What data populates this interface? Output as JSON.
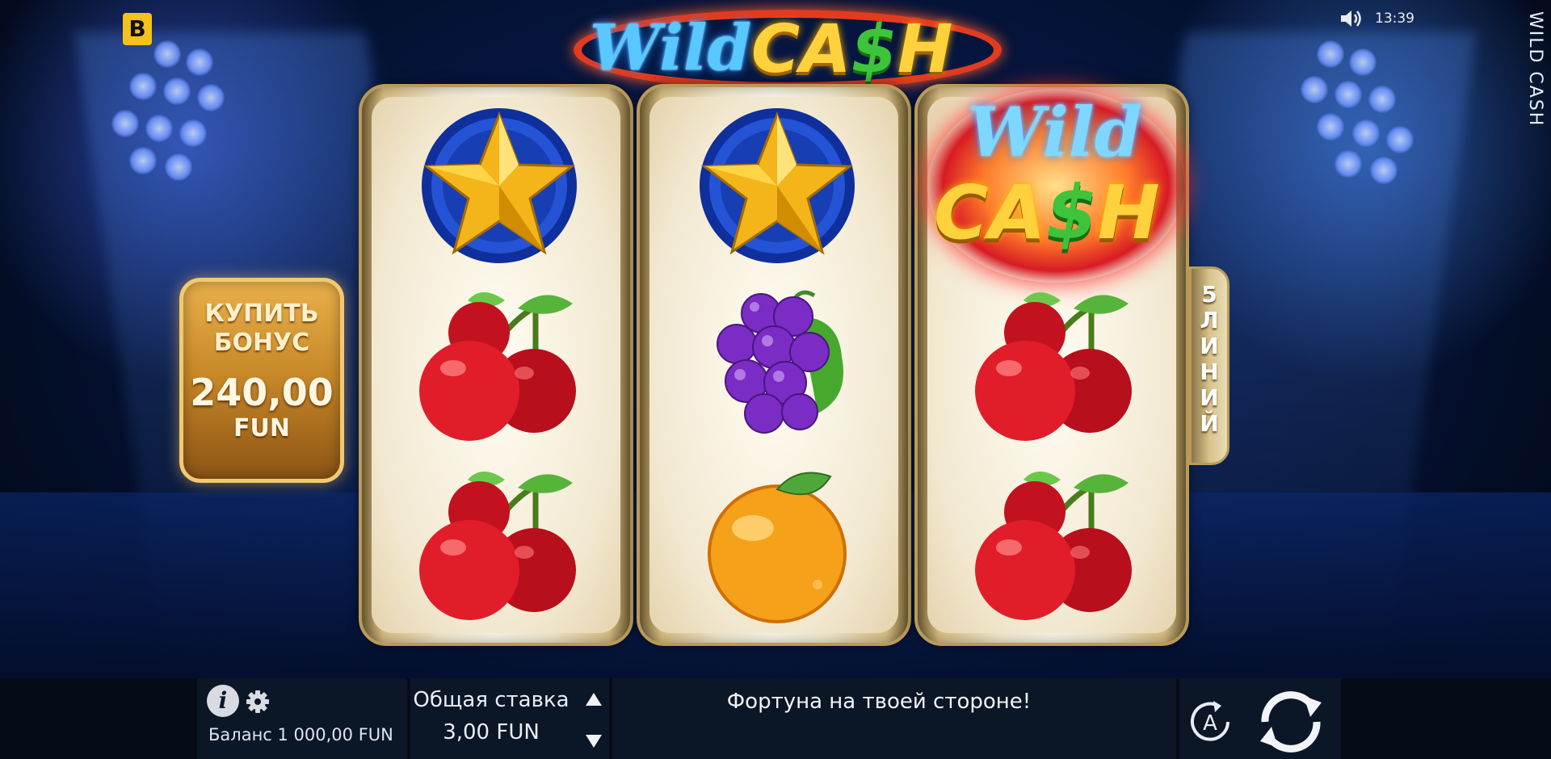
{
  "header": {
    "brand_logo_letter": "B",
    "time": "13:39",
    "side_title": "WILD CASH",
    "sound_icon": "speaker-icon"
  },
  "game_logo": {
    "word1": "Wild",
    "word2_part1": "CA",
    "word2_dollar": "$",
    "word2_part2": "H"
  },
  "buy_bonus": {
    "line1": "КУПИТЬ",
    "line2": "БОНУС",
    "amount": "240,00",
    "currency": "FUN"
  },
  "lines_tab": {
    "count": "5",
    "letters": [
      "Л",
      "И",
      "Н",
      "И",
      "Й"
    ]
  },
  "reels": [
    [
      "star",
      "cherry",
      "cherry"
    ],
    [
      "star",
      "grapes",
      "orange"
    ],
    [
      "wild",
      "cherry",
      "cherry"
    ]
  ],
  "wild_symbol": {
    "word1": "Wild",
    "word2_part1": "CA",
    "word2_dollar": "$",
    "word2_part2": "H"
  },
  "bottom_bar": {
    "balance": "Баланс 1 000,00 FUN",
    "bet_label": "Общая ставка",
    "bet_value": "3,00 FUN",
    "message": "Фортуна на твоей стороне!",
    "info_icon": "info-icon",
    "settings_icon": "gear-icon",
    "autoplay_icon": "autoplay-icon",
    "spin_icon": "spin-icon"
  },
  "colors": {
    "accent_gold": "#f4c21a",
    "bonus_gold": "#c98a2a",
    "wild_blue": "#58c8ff",
    "cash_yellow": "#ffd23d",
    "dollar_green": "#3ec43a",
    "bar_bg": "#0b1626"
  }
}
